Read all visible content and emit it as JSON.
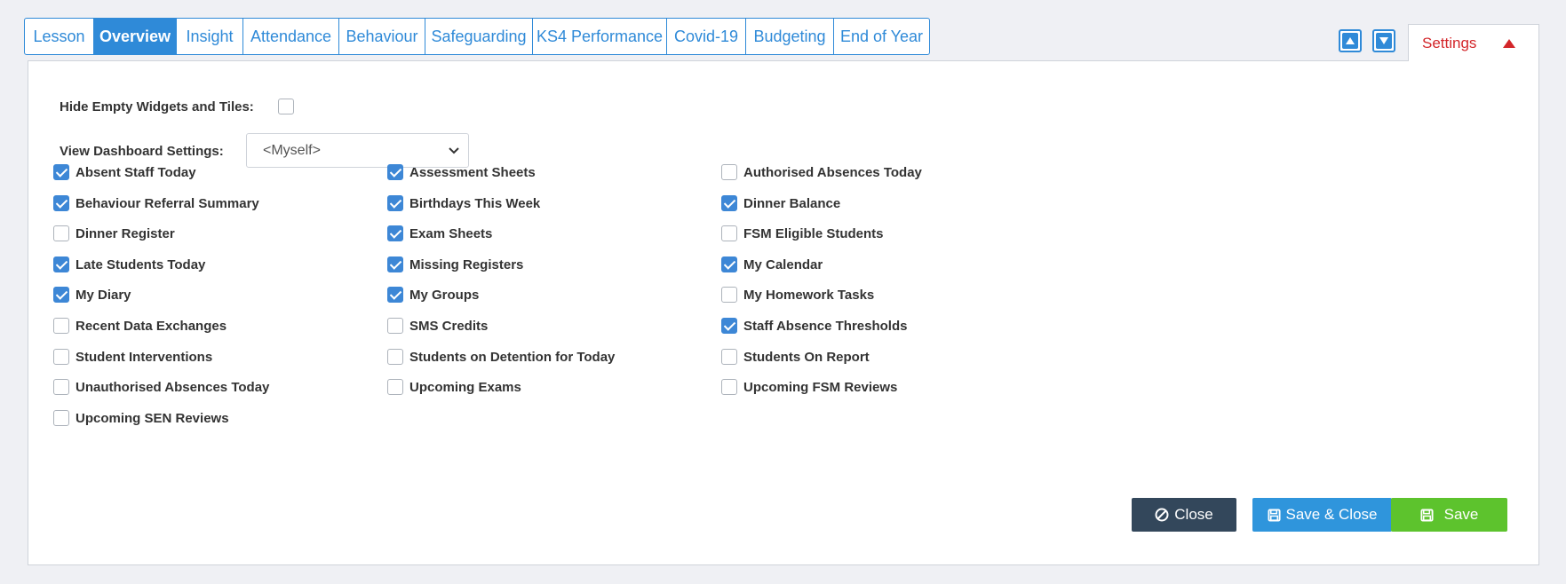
{
  "tabs": [
    {
      "label": "Lesson",
      "active": false
    },
    {
      "label": "Overview",
      "active": true
    },
    {
      "label": "Insight",
      "active": false
    },
    {
      "label": "Attendance",
      "active": false
    },
    {
      "label": "Behaviour",
      "active": false
    },
    {
      "label": "Safeguarding",
      "active": false
    },
    {
      "label": "KS4 Performance",
      "active": false
    },
    {
      "label": "Covid-19",
      "active": false
    },
    {
      "label": "Budgeting",
      "active": false
    },
    {
      "label": "End of Year",
      "active": false
    }
  ],
  "settings_tab": {
    "label": "Settings"
  },
  "hide_empty": {
    "label": "Hide Empty Widgets and Tiles:",
    "checked": false
  },
  "view_settings": {
    "label": "View Dashboard Settings:",
    "value": "<Myself>"
  },
  "widgets": {
    "col1": [
      {
        "label": "Absent Staff Today",
        "checked": true
      },
      {
        "label": "Behaviour Referral Summary",
        "checked": true
      },
      {
        "label": "Dinner Register",
        "checked": false
      },
      {
        "label": "Late Students Today",
        "checked": true
      },
      {
        "label": "My Diary",
        "checked": true
      },
      {
        "label": "Recent Data Exchanges",
        "checked": false
      },
      {
        "label": "Student Interventions",
        "checked": false
      },
      {
        "label": "Unauthorised Absences Today",
        "checked": false
      },
      {
        "label": "Upcoming SEN Reviews",
        "checked": false
      }
    ],
    "col2": [
      {
        "label": "Assessment Sheets",
        "checked": true
      },
      {
        "label": "Birthdays This Week",
        "checked": true
      },
      {
        "label": "Exam Sheets",
        "checked": true
      },
      {
        "label": "Missing Registers",
        "checked": true
      },
      {
        "label": "My Groups",
        "checked": true
      },
      {
        "label": "SMS Credits",
        "checked": false
      },
      {
        "label": "Students on Detention for Today",
        "checked": false
      },
      {
        "label": "Upcoming Exams",
        "checked": false
      }
    ],
    "col3": [
      {
        "label": "Authorised Absences Today",
        "checked": false
      },
      {
        "label": "Dinner Balance",
        "checked": true
      },
      {
        "label": "FSM Eligible Students",
        "checked": false
      },
      {
        "label": "My Calendar",
        "checked": true
      },
      {
        "label": "My Homework Tasks",
        "checked": false
      },
      {
        "label": "Staff Absence Thresholds",
        "checked": true
      },
      {
        "label": "Students On Report",
        "checked": false
      },
      {
        "label": "Upcoming FSM Reviews",
        "checked": false
      }
    ]
  },
  "buttons": {
    "close": "Close",
    "save_close": "Save & Close",
    "save": "Save"
  }
}
